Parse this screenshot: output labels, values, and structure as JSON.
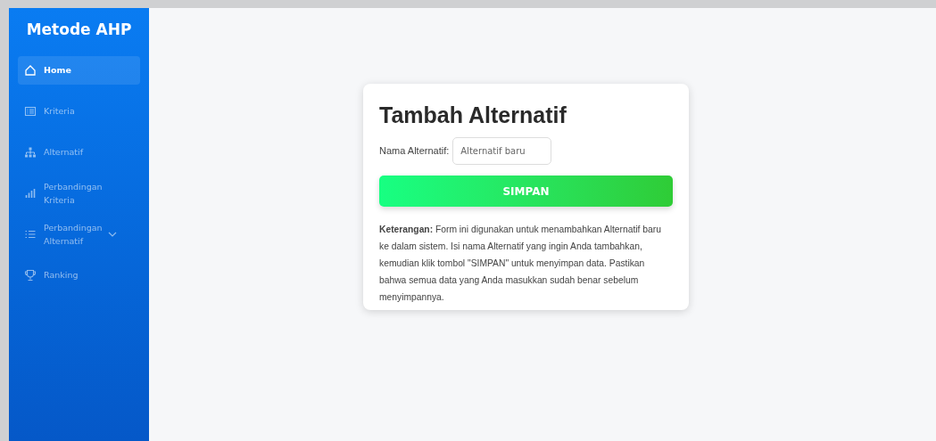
{
  "sidebar": {
    "title": "Metode AHP",
    "items": [
      {
        "label": "Home",
        "kind": "home",
        "selected": true
      },
      {
        "label": "Kriteria",
        "kind": "card",
        "selected": false
      },
      {
        "label": "Alternatif",
        "kind": "hierarchy",
        "selected": false
      },
      {
        "label": "Perbandingan Kriteria",
        "kind": "bars",
        "selected": false
      },
      {
        "label": "Perbandingan Alternatif",
        "kind": "list",
        "selected": false,
        "expanded": false
      },
      {
        "label": "Ranking",
        "kind": "trophy",
        "selected": false
      }
    ]
  },
  "form": {
    "title": "Tambah Alternatif",
    "field_label": "Nama Alternatif:",
    "placeholder": "Alternatif baru",
    "button": "SIMPAN",
    "note": "**Keterangan:** Form ini digunakan untuk menambahkan Alternatif baru ke dalam sistem. Isi nama Alternatif yang ingin Anda tambahkan, kemudian klik tombol \"SIMPAN\" untuk menyimpan data. Pastikan bahwa semua data yang Anda masukkan sudah benar sebelum menyimpannya."
  }
}
